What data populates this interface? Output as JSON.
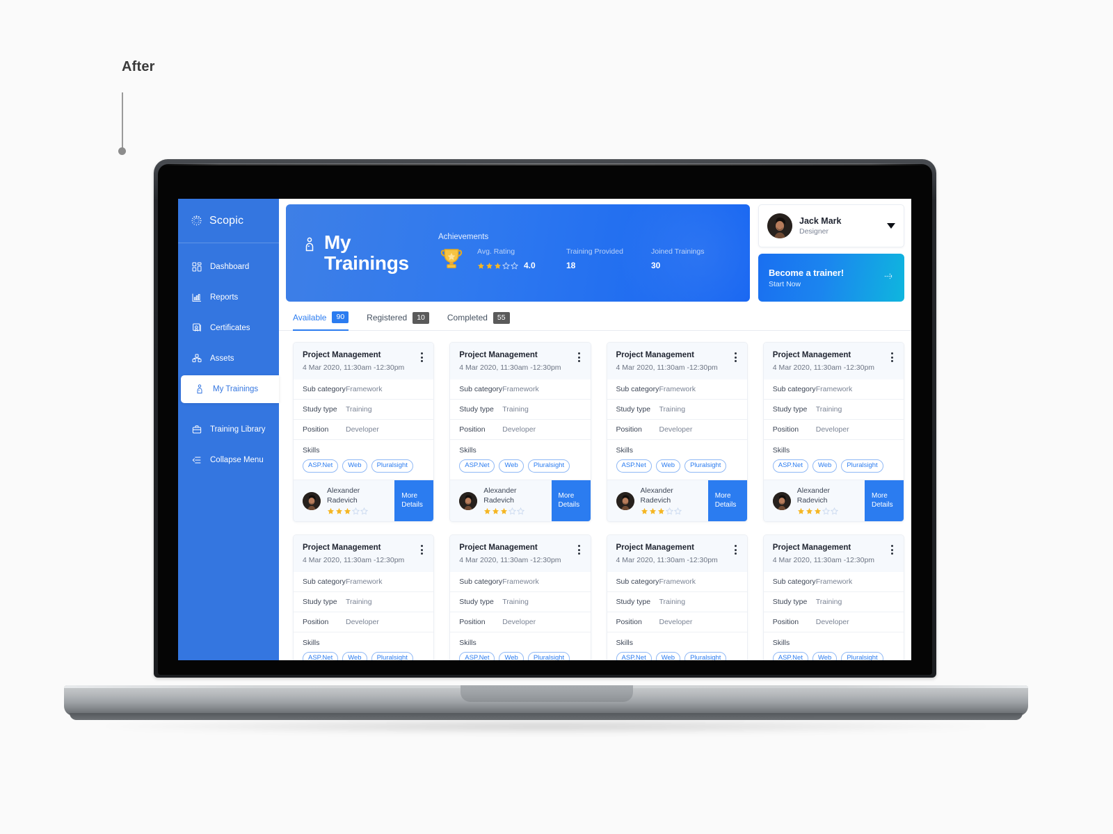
{
  "annotation": {
    "label": "After"
  },
  "app": {
    "brand": {
      "name": "Scopic",
      "logo_icon": "scopic-dots-logo-icon"
    },
    "sidebar": {
      "items": [
        {
          "label": "Dashboard",
          "icon": "dashboard-grid-icon",
          "active": false
        },
        {
          "label": "Reports",
          "icon": "bar-chart-icon",
          "active": false
        },
        {
          "label": "Certificates",
          "icon": "certificate-icon",
          "active": false
        },
        {
          "label": "Assets",
          "icon": "cubes-icon",
          "active": false
        },
        {
          "label": "My Trainings",
          "icon": "trainer-person-icon",
          "active": true
        },
        {
          "label": "Training Library",
          "icon": "briefcase-icon",
          "active": false
        },
        {
          "label": "Collapse Menu",
          "icon": "collapse-arrow-icon",
          "active": false
        }
      ]
    },
    "hero": {
      "title_line1": "My",
      "title_line2": "Trainings",
      "icon": "trainer-person-icon",
      "achievements": {
        "heading": "Achievements",
        "trophy_icon": "trophy-icon",
        "stats": [
          {
            "label": "Avg. Rating",
            "value": "4.0",
            "stars_filled": 3,
            "stars_total": 5
          },
          {
            "label": "Training Provided",
            "value": "18"
          },
          {
            "label": "Joined Trainings",
            "value": "30"
          }
        ]
      }
    },
    "profile": {
      "name": "Jack Mark",
      "role": "Designer",
      "avatar_icon": "user-avatar",
      "caret_icon": "chevron-down-icon"
    },
    "trainer_cta": {
      "title": "Become a trainer!",
      "subtitle": "Start Now",
      "arrow_icon": "arrow-right-icon"
    },
    "tabs": [
      {
        "label": "Available",
        "count": "90",
        "active": true
      },
      {
        "label": "Registered",
        "count": "10",
        "active": false
      },
      {
        "label": "Completed",
        "count": "55",
        "active": false
      }
    ],
    "card_template": {
      "title": "Project Management",
      "date": "4 Mar 2020, 11:30am -12:30pm",
      "menu_icon": "kebab-menu-icon",
      "rows": [
        {
          "key": "Sub category",
          "value": "Framework"
        },
        {
          "key": "Study type",
          "value": "Training"
        },
        {
          "key": "Position",
          "value": "Developer"
        }
      ],
      "skills_label": "Skills",
      "skills": [
        "ASP.Net",
        "Web",
        "Pluralsight"
      ],
      "trainer_name": "Alexander Radevich",
      "trainer_stars_filled": 3,
      "trainer_stars_total": 5,
      "more_line1": "More",
      "more_line2": "Details"
    },
    "cards": [
      {
        "id": "card-1"
      },
      {
        "id": "card-2"
      },
      {
        "id": "card-3"
      },
      {
        "id": "card-4"
      },
      {
        "id": "card-5"
      },
      {
        "id": "card-6"
      },
      {
        "id": "card-7"
      },
      {
        "id": "card-8"
      }
    ]
  },
  "colors": {
    "sidebar_blue": "#3476e0",
    "accent_blue": "#2b7cf0",
    "hero_gradient_from": "#3e7fe6",
    "hero_gradient_to": "#1766f2",
    "cta_gradient_from": "#1a6ff0",
    "cta_gradient_to": "#0fb6de",
    "star_gold": "#f5b623",
    "pill_gray": "#5a5a5a",
    "page_bg": "#fafafa"
  }
}
